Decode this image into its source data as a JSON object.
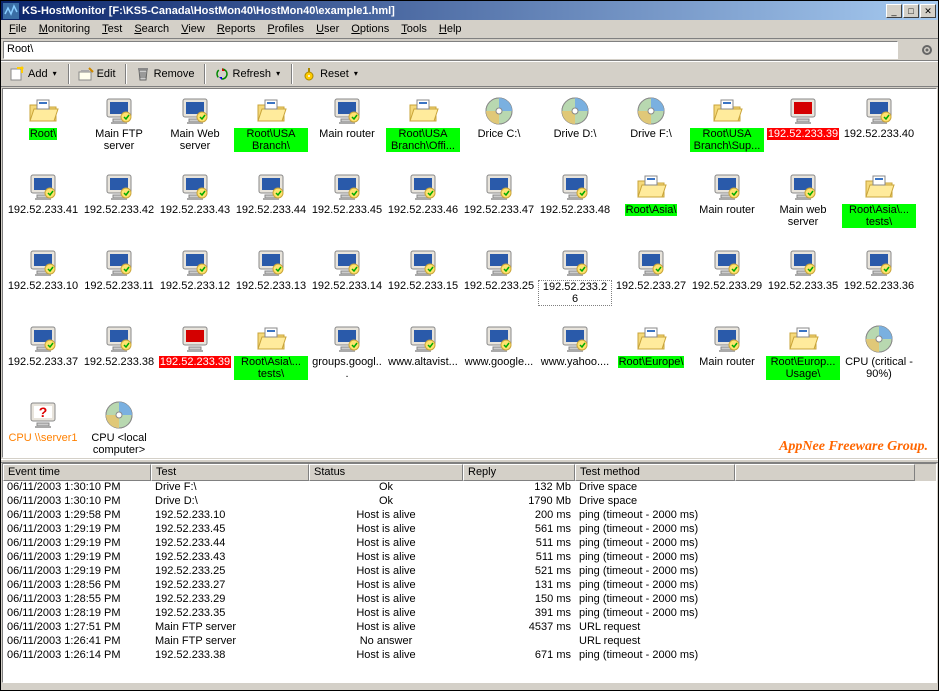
{
  "window": {
    "title": "KS-HostMonitor  [F:\\KS5-Canada\\HostMon40\\HostMon40\\example1.hml]"
  },
  "menu": [
    "File",
    "Monitoring",
    "Test",
    "Search",
    "View",
    "Reports",
    "Profiles",
    "User",
    "Options",
    "Tools",
    "Help"
  ],
  "path": "Root\\",
  "toolbar": {
    "add": "Add",
    "edit": "Edit",
    "remove": "Remove",
    "refresh": "Refresh",
    "reset": "Reset"
  },
  "watermark": "AppNee Freeware Group.",
  "icons": [
    {
      "label": "Root\\",
      "type": "folder",
      "hl": "green"
    },
    {
      "label": "Main FTP server",
      "type": "monitor"
    },
    {
      "label": "Main Web server",
      "type": "monitor"
    },
    {
      "label": "Root\\USA Branch\\",
      "type": "folder",
      "hl": "green"
    },
    {
      "label": "Main router",
      "type": "monitor"
    },
    {
      "label": "Root\\USA Branch\\Offi...",
      "type": "folder",
      "hl": "green"
    },
    {
      "label": "Drice C:\\",
      "type": "disk"
    },
    {
      "label": "Drive D:\\",
      "type": "disk"
    },
    {
      "label": "Drive F:\\",
      "type": "disk"
    },
    {
      "label": "Root\\USA Branch\\Sup...",
      "type": "folder",
      "hl": "green"
    },
    {
      "label": "192.52.233.39",
      "type": "monitor-red",
      "hl": "red"
    },
    {
      "label": "192.52.233.40",
      "type": "monitor"
    },
    {
      "label": "192.52.233.41",
      "type": "monitor"
    },
    {
      "label": "192.52.233.42",
      "type": "monitor"
    },
    {
      "label": "192.52.233.43",
      "type": "monitor"
    },
    {
      "label": "192.52.233.44",
      "type": "monitor"
    },
    {
      "label": "192.52.233.45",
      "type": "monitor"
    },
    {
      "label": "192.52.233.46",
      "type": "monitor"
    },
    {
      "label": "192.52.233.47",
      "type": "monitor"
    },
    {
      "label": "192.52.233.48",
      "type": "monitor"
    },
    {
      "label": "Root\\Asia\\",
      "type": "folder",
      "hl": "green"
    },
    {
      "label": "Main router",
      "type": "monitor"
    },
    {
      "label": "Main web server",
      "type": "monitor"
    },
    {
      "label": "Root\\Asia\\... tests\\",
      "type": "folder",
      "hl": "green"
    },
    {
      "label": "192.52.233.10",
      "type": "monitor"
    },
    {
      "label": "192.52.233.11",
      "type": "monitor"
    },
    {
      "label": "192.52.233.12",
      "type": "monitor"
    },
    {
      "label": "192.52.233.13",
      "type": "monitor"
    },
    {
      "label": "192.52.233.14",
      "type": "monitor"
    },
    {
      "label": "192.52.233.15",
      "type": "monitor"
    },
    {
      "label": "192.52.233.25",
      "type": "monitor"
    },
    {
      "label": "192.52.233.26",
      "type": "monitor",
      "sel": true
    },
    {
      "label": "192.52.233.27",
      "type": "monitor"
    },
    {
      "label": "192.52.233.29",
      "type": "monitor"
    },
    {
      "label": "192.52.233.35",
      "type": "monitor"
    },
    {
      "label": "192.52.233.36",
      "type": "monitor"
    },
    {
      "label": "192.52.233.37",
      "type": "monitor"
    },
    {
      "label": "192.52.233.38",
      "type": "monitor"
    },
    {
      "label": "192.52.233.39",
      "type": "monitor-red",
      "hl": "red"
    },
    {
      "label": "Root\\Asia\\... tests\\",
      "type": "folder",
      "hl": "green"
    },
    {
      "label": "groups.googl...",
      "type": "monitor"
    },
    {
      "label": "www.altavist...",
      "type": "monitor"
    },
    {
      "label": "www.google...",
      "type": "monitor"
    },
    {
      "label": "www.yahoo....",
      "type": "monitor"
    },
    {
      "label": "Root\\Europe\\",
      "type": "folder",
      "hl": "green"
    },
    {
      "label": "Main router",
      "type": "monitor"
    },
    {
      "label": "Root\\Europ... Usage\\",
      "type": "folder",
      "hl": "green"
    },
    {
      "label": "CPU (critical - 90%)",
      "type": "disk"
    },
    {
      "label": "CPU \\\\server1",
      "type": "monitor-unk",
      "hl": "orange"
    },
    {
      "label": "CPU <local computer>",
      "type": "disk"
    }
  ],
  "listColumns": [
    "Event time",
    "Test",
    "Status",
    "Reply",
    "Test method",
    ""
  ],
  "listRows": [
    {
      "time": "06/11/2003 1:30:10 PM",
      "test": "Drive F:\\",
      "status": "Ok",
      "reply": "132 Mb",
      "method": "Drive space"
    },
    {
      "time": "06/11/2003 1:30:10 PM",
      "test": "Drive D:\\",
      "status": "Ok",
      "reply": "1790 Mb",
      "method": "Drive space"
    },
    {
      "time": "06/11/2003 1:29:58 PM",
      "test": "192.52.233.10",
      "status": "Host is alive",
      "reply": "200 ms",
      "method": "ping (timeout - 2000 ms)"
    },
    {
      "time": "06/11/2003 1:29:19 PM",
      "test": "192.52.233.45",
      "status": "Host is alive",
      "reply": "561 ms",
      "method": "ping (timeout - 2000 ms)"
    },
    {
      "time": "06/11/2003 1:29:19 PM",
      "test": "192.52.233.44",
      "status": "Host is alive",
      "reply": "511 ms",
      "method": "ping (timeout - 2000 ms)"
    },
    {
      "time": "06/11/2003 1:29:19 PM",
      "test": "192.52.233.43",
      "status": "Host is alive",
      "reply": "511 ms",
      "method": "ping (timeout - 2000 ms)"
    },
    {
      "time": "06/11/2003 1:29:19 PM",
      "test": "192.52.233.25",
      "status": "Host is alive",
      "reply": "521 ms",
      "method": "ping (timeout - 2000 ms)"
    },
    {
      "time": "06/11/2003 1:28:56 PM",
      "test": "192.52.233.27",
      "status": "Host is alive",
      "reply": "131 ms",
      "method": "ping (timeout - 2000 ms)"
    },
    {
      "time": "06/11/2003 1:28:55 PM",
      "test": "192.52.233.29",
      "status": "Host is alive",
      "reply": "150 ms",
      "method": "ping (timeout - 2000 ms)"
    },
    {
      "time": "06/11/2003 1:28:19 PM",
      "test": "192.52.233.35",
      "status": "Host is alive",
      "reply": "391 ms",
      "method": "ping (timeout - 2000 ms)"
    },
    {
      "time": "06/11/2003 1:27:51 PM",
      "test": "Main FTP server",
      "status": "Host is alive",
      "reply": "4537 ms",
      "method": "URL request"
    },
    {
      "time": "06/11/2003 1:26:41 PM",
      "test": "Main FTP server",
      "status": "No answer",
      "reply": "",
      "method": "URL request"
    },
    {
      "time": "06/11/2003 1:26:14 PM",
      "test": "192.52.233.38",
      "status": "Host is alive",
      "reply": "671 ms",
      "method": "ping (timeout - 2000 ms)"
    }
  ]
}
